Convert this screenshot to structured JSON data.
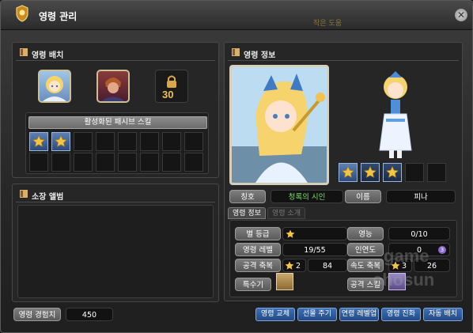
{
  "window": {
    "title": "영령 관리",
    "watermark_top": "작은 도움"
  },
  "placement": {
    "header": "영령 배치",
    "locked_level": "30",
    "passive_skill_label": "활성화된 패시브 스킬",
    "passive_slots": [
      "star",
      "star",
      "empty",
      "empty",
      "empty",
      "empty",
      "empty",
      "empty",
      "empty",
      "empty",
      "empty",
      "empty",
      "empty",
      "empty",
      "empty",
      "empty"
    ]
  },
  "album": {
    "header": "소장 앨범"
  },
  "exp": {
    "label": "영령 경험치",
    "value": "450"
  },
  "info": {
    "header": "영령 정보",
    "skill_slots": [
      "star",
      "star-dark",
      "star-dark",
      "empty",
      "empty"
    ],
    "title_label": "칭호",
    "title_value": "청록의 시인",
    "name_label": "이름",
    "name_value": "피나",
    "tabs": [
      {
        "label": "영령 정보",
        "active": true
      },
      {
        "label": "영령 소개",
        "active": false
      }
    ],
    "stats": {
      "grade_label": "별 등급",
      "ability_label": "영능",
      "ability_value": "0/10",
      "level_label": "영령 레벨",
      "level_value": "19/55",
      "bond_label": "인연도",
      "bond_value": "0",
      "bond_badge": "3",
      "atk_label": "공격 축복",
      "atk_stars": "2",
      "atk_value": "84",
      "spd_label": "속도 축복",
      "spd_stars": "3",
      "spd_value": "26",
      "special_label": "특수기",
      "attack_skill_label": "공격 스킬"
    }
  },
  "buttons": [
    "영령 교체",
    "선물 주기",
    "연령 레벨업",
    "영령 진화",
    "자동 배치"
  ],
  "watermark": {
    "line1": "game",
    "line2": "chosun"
  },
  "colors": {
    "title_value": "#6fe05a",
    "button_bg": "#2f5ea0",
    "star": "#f4c542"
  }
}
